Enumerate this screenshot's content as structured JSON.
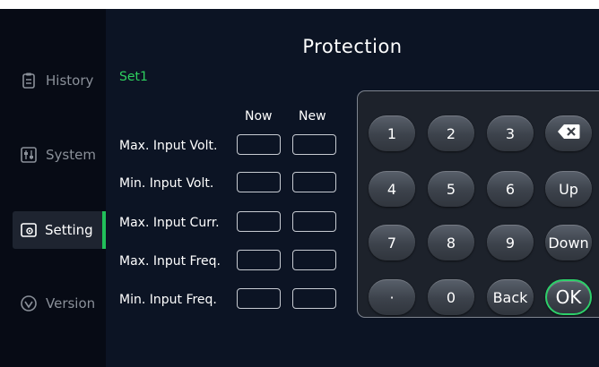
{
  "sidebar": {
    "items": [
      {
        "label": "History",
        "icon": "clipboard-icon",
        "active": false
      },
      {
        "label": "System",
        "icon": "sliders-icon",
        "active": false
      },
      {
        "label": "Setting",
        "icon": "gear-window-icon",
        "active": true
      },
      {
        "label": "Version",
        "icon": "check-circle-icon",
        "active": false
      }
    ]
  },
  "header": {
    "title": "Protection"
  },
  "form": {
    "set_label": "Set1",
    "columns": {
      "now": "Now",
      "new": "New"
    },
    "rows": [
      {
        "label": "Max. Input Volt.",
        "now": "",
        "new": ""
      },
      {
        "label": "Min. Input Volt.",
        "now": "",
        "new": ""
      },
      {
        "label": "Max. Input Curr.",
        "now": "",
        "new": ""
      },
      {
        "label": "Max. Input Freq.",
        "now": "",
        "new": ""
      },
      {
        "label": "Min. Input Freq.",
        "now": "",
        "new": ""
      }
    ]
  },
  "keypad": {
    "keys": [
      [
        "1",
        "2",
        "3",
        "⌫"
      ],
      [
        "4",
        "5",
        "6",
        "Up"
      ],
      [
        "7",
        "8",
        "9",
        "Down"
      ],
      [
        "·",
        "0",
        "Back",
        "OK"
      ]
    ],
    "backspace_icon": "backspace-icon"
  },
  "colors": {
    "background": "#0c1424",
    "sidebar": "#070b15",
    "accent_green": "#2ed05f",
    "text": "#ffffff",
    "muted": "#8a9099"
  }
}
